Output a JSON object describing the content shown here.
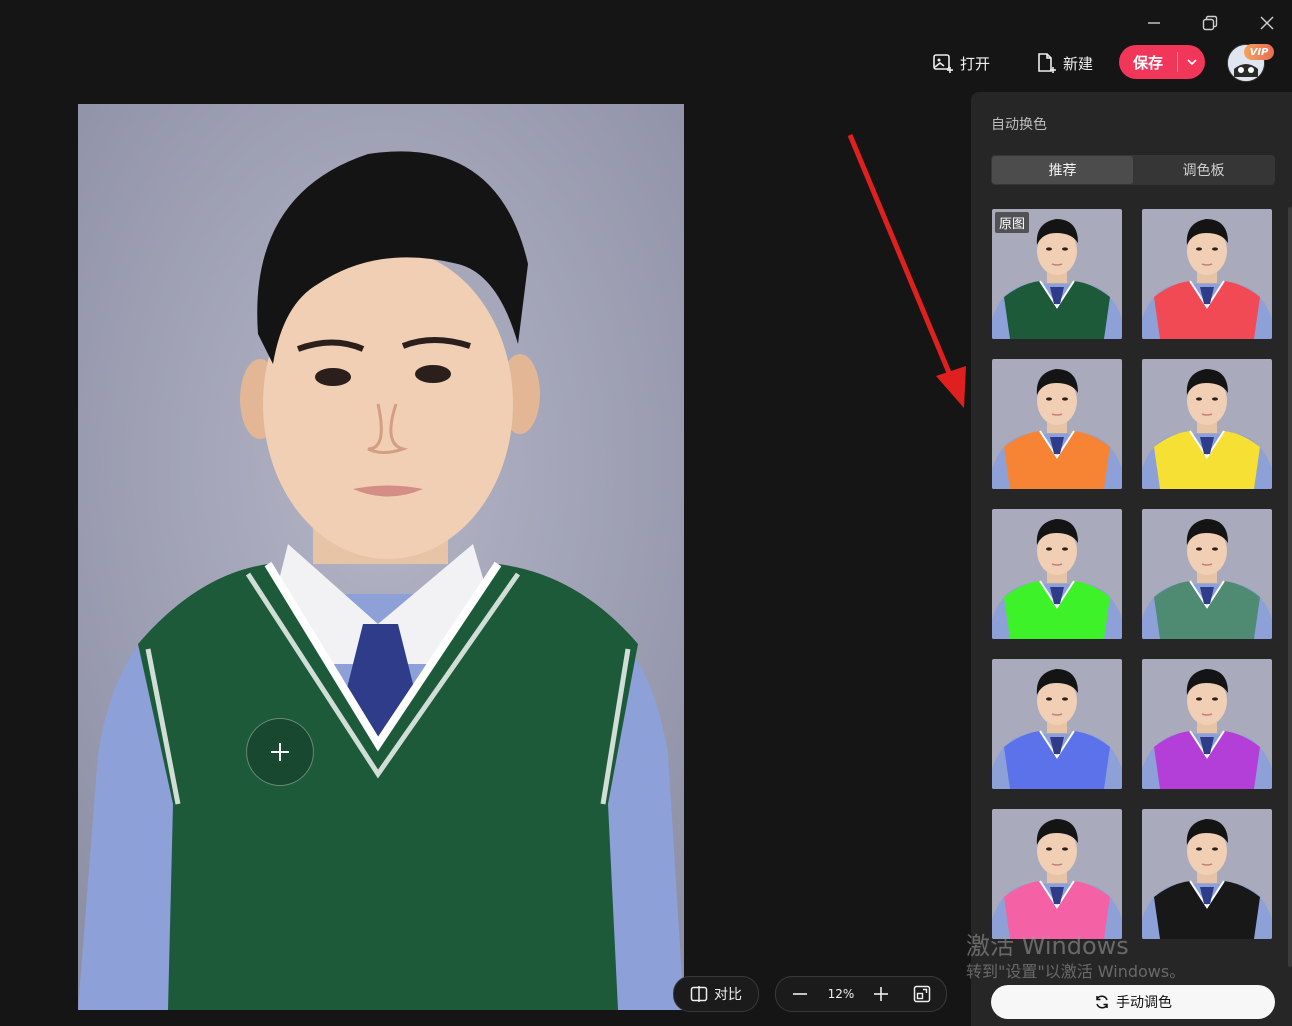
{
  "toolbar": {
    "open_label": "打开",
    "new_label": "新建",
    "save_label": "保存"
  },
  "user": {
    "vip_badge": "VIP"
  },
  "canvas": {
    "compare_label": "对比",
    "zoom_level": "12%"
  },
  "panel": {
    "title": "自动换色",
    "tabs": [
      {
        "label": "推荐",
        "active": true
      },
      {
        "label": "调色板",
        "active": false
      }
    ],
    "presets": [
      {
        "label": "原图",
        "color": "#1d5a3a"
      },
      {
        "color": "#f24a55"
      },
      {
        "color": "#f78434"
      },
      {
        "color": "#f5e033"
      },
      {
        "color": "#3ef22a"
      },
      {
        "color": "#4f8a73"
      },
      {
        "color": "#5b72ea"
      },
      {
        "color": "#b43fd8"
      },
      {
        "color": "#f461a4"
      },
      {
        "color": "#181818"
      }
    ],
    "manual_button": "手动调色"
  },
  "watermark": {
    "line1": "激活 Windows",
    "line2": "转到\"设置\"以激活 Windows。"
  },
  "colors": {
    "accent": "#f2365a",
    "vest_original": "#1d5a3a"
  }
}
